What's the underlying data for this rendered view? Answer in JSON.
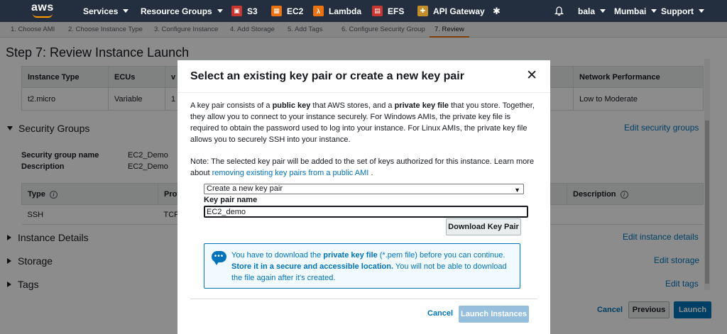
{
  "topnav": {
    "logo": "aws",
    "services": "Services",
    "resource_groups": "Resource Groups",
    "shortcuts": [
      {
        "label": "S3",
        "icon": "s3-icon",
        "color": "#c7372f"
      },
      {
        "label": "EC2",
        "icon": "ec2-icon",
        "color": "#ec7211"
      },
      {
        "label": "Lambda",
        "icon": "lambda-icon",
        "color": "#ec7211"
      },
      {
        "label": "EFS",
        "icon": "efs-icon",
        "color": "#c7372f"
      },
      {
        "label": "API Gateway",
        "icon": "api-gateway-icon",
        "color": "#c18e2b"
      }
    ],
    "user": "bala",
    "region": "Mumbai",
    "support": "Support"
  },
  "steps": [
    "1. Choose AMI",
    "2. Choose Instance Type",
    "3. Configure Instance",
    "4. Add Storage",
    "5. Add Tags",
    "6. Configure Security Group",
    "7. Review"
  ],
  "page": {
    "title": "Step 7: Review Instance Launch",
    "instance_table": {
      "headers": [
        "Instance Type",
        "ECUs",
        "v",
        "Network Performance"
      ],
      "row": [
        "t2.micro",
        "Variable",
        "1",
        "Low to Moderate"
      ]
    },
    "security_groups": {
      "title": "Security Groups",
      "edit": "Edit security groups",
      "name_label": "Security group name",
      "name_value": "EC2_Demo",
      "desc_label": "Description",
      "desc_value": "EC2_Demo",
      "table_headers": [
        "Type",
        "Prot",
        "Description"
      ],
      "row": [
        "SSH",
        "TCP"
      ]
    },
    "sections": [
      {
        "title": "Instance Details",
        "edit": "Edit instance details"
      },
      {
        "title": "Storage",
        "edit": "Edit storage"
      },
      {
        "title": "Tags",
        "edit": "Edit tags"
      }
    ],
    "buttons": {
      "cancel": "Cancel",
      "previous": "Previous",
      "launch": "Launch"
    }
  },
  "modal": {
    "title": "Select an existing key pair or create a new key pair",
    "p1_a": "A key pair consists of a ",
    "p1_public": "public key",
    "p1_b": " that AWS stores, and a ",
    "p1_private": "private key file",
    "p1_c": " that you store. Together, they allow you to connect to your instance securely. For Windows AMIs, the private key file is required to obtain the password used to log into your instance. For Linux AMIs, the private key file allows you to securely SSH into your instance.",
    "p2_a": "Note: The selected key pair will be added to the set of keys authorized for this instance. Learn more about ",
    "p2_link": "removing existing key pairs from a public AMI",
    "p2_b": " .",
    "select_value": "Create a new key pair",
    "field_label": "Key pair name",
    "input_value": "EC2_demo",
    "download_button": "Download Key Pair",
    "alert_a": "You have to download the ",
    "alert_b": "private key file",
    "alert_c": " (*.pem file) before you can continue. ",
    "alert_d": "Store it in a secure and accessible location.",
    "alert_e": " You will not be able to download the file again after it's created.",
    "cancel": "Cancel",
    "launch": "Launch Instances"
  }
}
